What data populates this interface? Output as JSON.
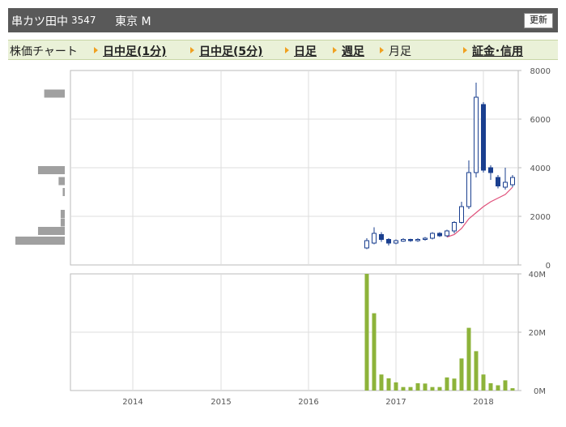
{
  "header": {
    "name": "串カツ田中",
    "code": "3547",
    "market": "東京 M",
    "refresh_label": "更新"
  },
  "tabs": [
    {
      "label": "株価チャート",
      "link": false,
      "arrow": false
    },
    {
      "label": "日中足(1分)",
      "link": true,
      "arrow": true
    },
    {
      "label": "日中足(5分)",
      "link": true,
      "arrow": true
    },
    {
      "label": "日足",
      "link": true,
      "arrow": true
    },
    {
      "label": "週足",
      "link": true,
      "arrow": true
    },
    {
      "label": "月足",
      "link": false,
      "arrow": true
    },
    {
      "label": "証金･信用",
      "link": true,
      "arrow": true
    }
  ],
  "colors": {
    "candle_up_fill": "#ffffff",
    "candle_up_stroke": "#1a3f8f",
    "candle_down": "#1a3f8f",
    "moving_average": "#e0507a",
    "volume_bar": "#8db33a",
    "volume_profile": "#a0a0a0",
    "grid": "#dddddd",
    "frame": "#bbbbbb"
  },
  "chart_data": [
    {
      "type": "candlestick",
      "title": "",
      "x_tick_labels": [
        "2014",
        "2015",
        "2016",
        "2017",
        "2018"
      ],
      "ylim": [
        0,
        8000
      ],
      "y_ticks": [
        0,
        2000,
        4000,
        6000,
        8000
      ],
      "y_tick_labels": [
        "0",
        "2000",
        "4000",
        "6000",
        "8000"
      ],
      "grid": true,
      "candles": [
        {
          "month": "2016-09",
          "open": 700,
          "high": 1100,
          "low": 650,
          "close": 1000
        },
        {
          "month": "2016-10",
          "open": 900,
          "high": 1550,
          "low": 850,
          "close": 1300
        },
        {
          "month": "2016-11",
          "open": 1250,
          "high": 1350,
          "low": 950,
          "close": 1050
        },
        {
          "month": "2016-12",
          "open": 1050,
          "high": 1100,
          "low": 800,
          "close": 900
        },
        {
          "month": "2017-01",
          "open": 900,
          "high": 1050,
          "low": 850,
          "close": 1000
        },
        {
          "month": "2017-02",
          "open": 980,
          "high": 1100,
          "low": 950,
          "close": 1050
        },
        {
          "month": "2017-03",
          "open": 1050,
          "high": 1080,
          "low": 950,
          "close": 1000
        },
        {
          "month": "2017-04",
          "open": 1000,
          "high": 1100,
          "low": 950,
          "close": 1050
        },
        {
          "month": "2017-05",
          "open": 1050,
          "high": 1150,
          "low": 1000,
          "close": 1100
        },
        {
          "month": "2017-06",
          "open": 1100,
          "high": 1350,
          "low": 1050,
          "close": 1300
        },
        {
          "month": "2017-07",
          "open": 1300,
          "high": 1350,
          "low": 1150,
          "close": 1200
        },
        {
          "month": "2017-08",
          "open": 1200,
          "high": 1450,
          "low": 1150,
          "close": 1400
        },
        {
          "month": "2017-09",
          "open": 1400,
          "high": 1800,
          "low": 1300,
          "close": 1750
        },
        {
          "month": "2017-10",
          "open": 1750,
          "high": 2600,
          "low": 1700,
          "close": 2400
        },
        {
          "month": "2017-11",
          "open": 2400,
          "high": 4300,
          "low": 2300,
          "close": 3800
        },
        {
          "month": "2017-12",
          "open": 3800,
          "high": 7500,
          "low": 3600,
          "close": 6900
        },
        {
          "month": "2018-01",
          "open": 6600,
          "high": 6700,
          "low": 3800,
          "close": 3900
        },
        {
          "month": "2018-02",
          "open": 4000,
          "high": 4100,
          "low": 3500,
          "close": 3800
        },
        {
          "month": "2018-03",
          "open": 3600,
          "high": 3700,
          "low": 3150,
          "close": 3250
        },
        {
          "month": "2018-04",
          "open": 3200,
          "high": 4000,
          "low": 3100,
          "close": 3400
        },
        {
          "month": "2018-05",
          "open": 3300,
          "high": 3700,
          "low": 3200,
          "close": 3600
        }
      ],
      "moving_average": [
        {
          "month": "2017-08",
          "value": 1150
        },
        {
          "month": "2017-09",
          "value": 1250
        },
        {
          "month": "2017-10",
          "value": 1500
        },
        {
          "month": "2017-11",
          "value": 1900
        },
        {
          "month": "2017-12",
          "value": 2150
        },
        {
          "month": "2018-01",
          "value": 2400
        },
        {
          "month": "2018-02",
          "value": 2600
        },
        {
          "month": "2018-03",
          "value": 2750
        },
        {
          "month": "2018-04",
          "value": 2900
        },
        {
          "month": "2018-05",
          "value": 3200
        }
      ],
      "volume_profile": [
        {
          "price": 7050,
          "value": 1.0
        },
        {
          "price": 3900,
          "value": 1.3
        },
        {
          "price": 3450,
          "value": 0.3
        },
        {
          "price": 3000,
          "value": 0.1
        },
        {
          "price": 2100,
          "value": 0.2
        },
        {
          "price": 1750,
          "value": 0.2
        },
        {
          "price": 1400,
          "value": 1.3
        },
        {
          "price": 1000,
          "value": 2.4
        }
      ]
    },
    {
      "type": "bar",
      "title": "",
      "ylim": [
        0,
        40
      ],
      "y_ticks": [
        0,
        20,
        40
      ],
      "y_tick_labels": [
        "0M",
        "20M",
        "40M"
      ],
      "grid": true,
      "categories": [
        "2016-09",
        "2016-10",
        "2016-11",
        "2016-12",
        "2017-01",
        "2017-02",
        "2017-03",
        "2017-04",
        "2017-05",
        "2017-06",
        "2017-07",
        "2017-08",
        "2017-09",
        "2017-10",
        "2017-11",
        "2017-12",
        "2018-01",
        "2018-02",
        "2018-03",
        "2018-04",
        "2018-05"
      ],
      "values": [
        40,
        26.5,
        5.5,
        4.2,
        2.8,
        1.2,
        1.2,
        2.5,
        2.4,
        1.2,
        1.2,
        4.5,
        4.1,
        11,
        21.5,
        13.5,
        5.5,
        2.5,
        1.8,
        3.5,
        0.8
      ]
    }
  ]
}
